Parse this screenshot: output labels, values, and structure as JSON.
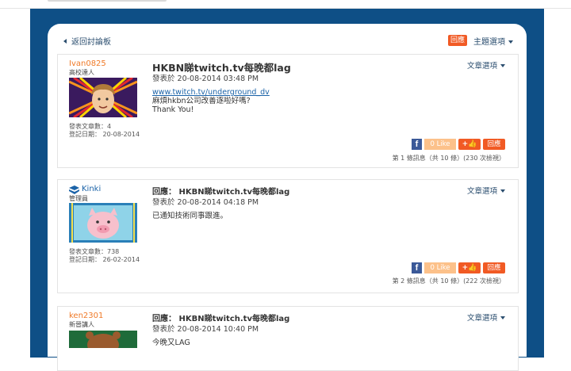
{
  "nav": {
    "back_label": "返回討論板",
    "reply_label": "回應",
    "topic_options": "主題選項"
  },
  "posts": [
    {
      "username": "Ivan0825",
      "role": "高校達人",
      "posts_label": "發表文章數：4",
      "reg_label": "登記日期： 20-08-2014",
      "title": "HKBN睇twitch.tv每晚都lag",
      "date": "發表於 20-08-2014 03:48 PM",
      "body": [
        "www.twitch.tv/underground_dv",
        "麻煩hkbn公司改善逐啦好嗎?",
        "Thank You!"
      ],
      "article_options": "文章選項",
      "like": "0 Like",
      "reply": "回應",
      "count": "第 1 條訊息（共 10 條）(230 次檢視）"
    },
    {
      "username": "Kinki",
      "role": "管理員",
      "posts_label": "發表文章數：738",
      "reg_label": "登記日期： 26-02-2014",
      "title": "回應： HKBN睇twitch.tv每晚都lag",
      "date": "發表於 20-08-2014 04:18 PM",
      "body": [
        "已通知技術同事跟進。"
      ],
      "article_options": "文章選項",
      "like": "0 Like",
      "reply": "回應",
      "count": "第 2 條訊息（共 10 條）(222 次檢視）"
    },
    {
      "username": "ken2301",
      "role": "新晉講人",
      "title": "回應： HKBN睇twitch.tv每晚都lag",
      "date": "發表於 20-08-2014 10:40 PM",
      "body": [
        "今晚又LAG"
      ],
      "article_options": "文章選項"
    }
  ]
}
